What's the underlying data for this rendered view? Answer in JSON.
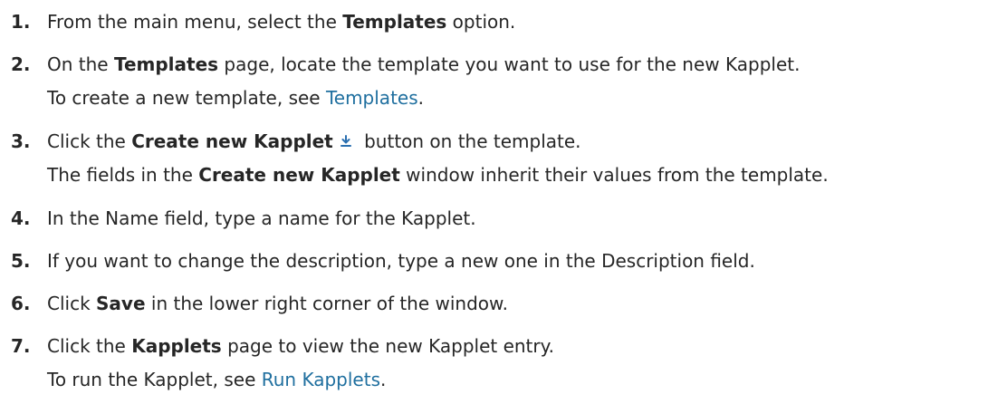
{
  "steps": [
    {
      "number": "1.",
      "lines": [
        {
          "a": "From the main menu, select the ",
          "b": "Templates",
          "c": " option."
        }
      ]
    },
    {
      "number": "2.",
      "lines": [
        {
          "a": "On the ",
          "b": "Templates",
          "c": " page, locate the template you want to use for the new Kapplet."
        },
        {
          "a": "To create a new template, see ",
          "link": "Templates",
          "c": "."
        }
      ]
    },
    {
      "number": "3.",
      "lines": [
        {
          "a": "Click the ",
          "b": "Create new Kapplet",
          "c": " button on the template.",
          "icon": "download-icon"
        },
        {
          "a": "The fields in the ",
          "b": "Create new Kapplet",
          "c": " window inherit their values from the template."
        }
      ]
    },
    {
      "number": "4.",
      "lines": [
        {
          "a": "In the Name field, type a name for the Kapplet."
        }
      ]
    },
    {
      "number": "5.",
      "lines": [
        {
          "a": "If you want to change the description, type a new one in the Description field."
        }
      ]
    },
    {
      "number": "6.",
      "lines": [
        {
          "a": "Click ",
          "b": "Save",
          "c": " in the lower right corner of the window."
        }
      ]
    },
    {
      "number": "7.",
      "lines": [
        {
          "a": "Click the ",
          "b": "Kapplets",
          "c": " page to view the new Kapplet entry."
        },
        {
          "a": "To run the Kapplet, see ",
          "link": "Run Kapplets",
          "c": "."
        }
      ]
    }
  ],
  "colors": {
    "text": "#262626",
    "link": "#1f6f9f",
    "icon": "#2a6fb0"
  }
}
